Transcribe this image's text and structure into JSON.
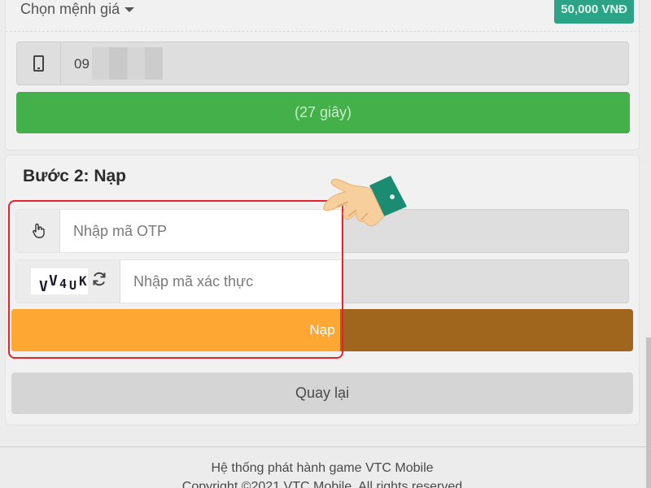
{
  "step1": {
    "denomination_label": "Chọn mệnh giá",
    "denomination_badge": "50,000 VNĐ",
    "phone_value": "09",
    "countdown_button": "(27 giây)"
  },
  "step2": {
    "title": "Bước 2: Nạp",
    "otp_placeholder": "Nhập mã OTP",
    "captcha_text": [
      "V",
      "V",
      "4",
      "U",
      "K"
    ],
    "captcha_placeholder": "Nhập mã xác thực",
    "submit_label": "Nạp",
    "back_label": "Quay lại"
  },
  "footer": {
    "line1": "Hệ thống phát hành game VTC Mobile",
    "line2": "Copyright ©2021 VTC Mobile. All rights reserved"
  },
  "icons": {
    "phone": "phone-icon",
    "hand": "hand-pointer-icon",
    "refresh": "refresh-icon",
    "caret": "caret-down-icon"
  },
  "colors": {
    "badge": "#2aa386",
    "countdown": "#44b04a",
    "submit": "#ffa733",
    "highlight_border": "#e3262b"
  }
}
